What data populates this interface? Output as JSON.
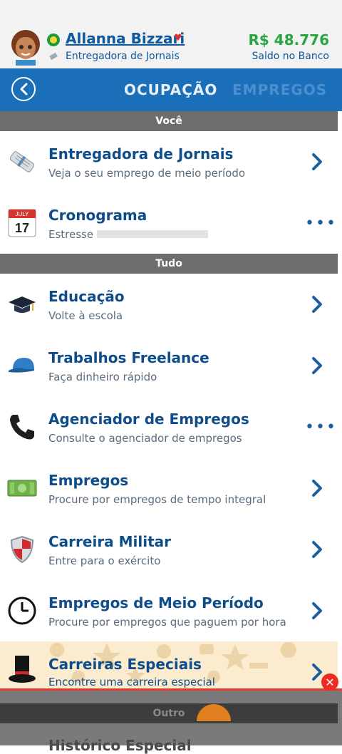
{
  "header": {
    "name": "Allanna Bizzari",
    "occupation": "Entregadora de Jornais",
    "money": "R$ 48.776",
    "money_label": "Saldo no Banco"
  },
  "nav": {
    "tab_active": "OCUPAÇÃO",
    "tab_inactive": "EMPREGOS"
  },
  "sections": {
    "voce": "Você",
    "tudo": "Tudo",
    "outro": "Outro"
  },
  "rows": [
    {
      "title": "Entregadora de Jornais",
      "subtitle": "Veja o seu emprego de meio período",
      "icon": "newspaper-icon",
      "action": "chevron"
    },
    {
      "title": "Cronograma",
      "subtitle": "Estresse",
      "icon": "calendar-icon",
      "calendar_month": "JULY",
      "calendar_day": "17",
      "action": "more"
    },
    {
      "title": "Educação",
      "subtitle": "Volte à escola",
      "icon": "graduation-cap-icon",
      "action": "chevron"
    },
    {
      "title": "Trabalhos Freelance",
      "subtitle": "Faça dinheiro rápido",
      "icon": "cap-icon",
      "action": "chevron"
    },
    {
      "title": "Agenciador de Empregos",
      "subtitle": "Consulte o agenciador de empregos",
      "icon": "phone-icon",
      "action": "more"
    },
    {
      "title": "Empregos",
      "subtitle": "Procure por empregos de tempo integral",
      "icon": "money-icon",
      "action": "chevron"
    },
    {
      "title": "Carreira Militar",
      "subtitle": "Entre para o exército",
      "icon": "shield-icon",
      "action": "chevron"
    },
    {
      "title": "Empregos de Meio Período",
      "subtitle": "Procure por empregos que paguem por hora",
      "icon": "clock-icon",
      "action": "chevron"
    },
    {
      "title": "Carreiras Especiais",
      "subtitle": "Encontre uma carreira especial",
      "icon": "top-hat-icon",
      "action": "chevron"
    }
  ],
  "ghost_text": "Histórico Especial",
  "colors": {
    "accent_blue": "#1b6fb9",
    "title_blue": "#0e4d8a",
    "money_green": "#2aa541",
    "section_gray": "#6d6d6d",
    "close_red": "#ef2b21"
  }
}
